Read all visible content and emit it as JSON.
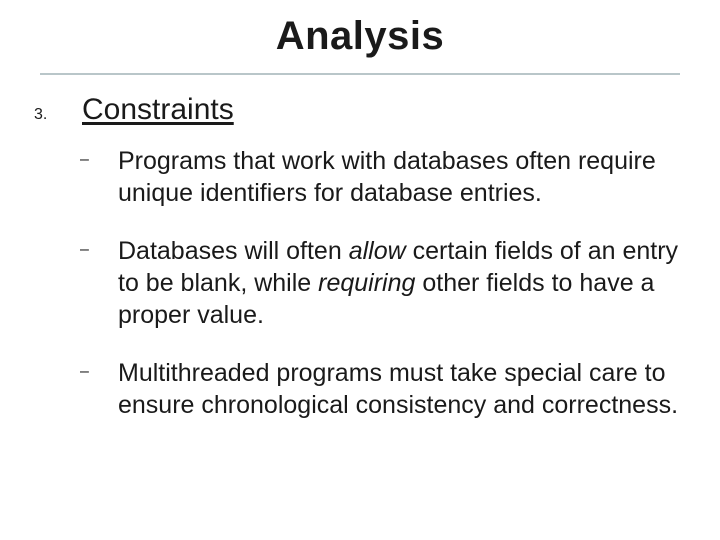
{
  "title": "Analysis",
  "section_number": "3.",
  "section_heading": "Constraints",
  "bullets": {
    "b0": "Programs that work with databases often require unique identifiers for database entries.",
    "b1_pre": "Databases will often ",
    "b1_i1": "allow",
    "b1_mid": " certain fields of an entry to be blank, while ",
    "b1_i2": "requiring",
    "b1_post": " other fields to have a proper value.",
    "b2": "Multithreaded programs must take special care to ensure chronological consistency and correctness."
  }
}
